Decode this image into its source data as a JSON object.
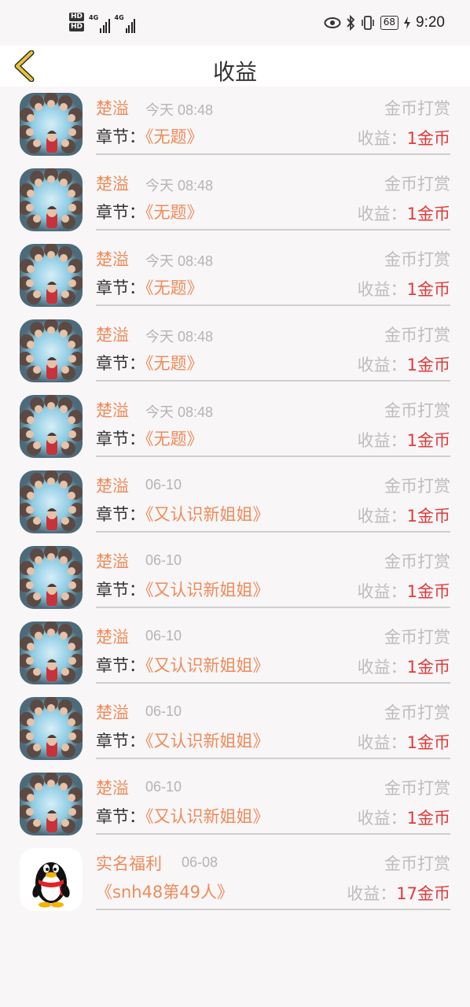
{
  "status_bar": {
    "hd1": "HD",
    "hd2": "HD",
    "net1": "4G",
    "net2": "4G",
    "battery": "68",
    "time": "9:20"
  },
  "header": {
    "title": "收益"
  },
  "colors": {
    "accent_orange": "#ed8b5a",
    "earn_red": "#e03a3a",
    "muted_gray": "#bdbdbd",
    "back_icon_yellow": "#e7c23a"
  },
  "items": [
    {
      "name": "楚溢",
      "time": "今天 08:48",
      "type": "金币打赏",
      "chapter_label": "章节：",
      "chapter_title": "《无题》",
      "earn_label": "收益：",
      "earn_value": "1金币",
      "avatar": "group-photo"
    },
    {
      "name": "楚溢",
      "time": "今天 08:48",
      "type": "金币打赏",
      "chapter_label": "章节：",
      "chapter_title": "《无题》",
      "earn_label": "收益：",
      "earn_value": "1金币",
      "avatar": "group-photo"
    },
    {
      "name": "楚溢",
      "time": "今天 08:48",
      "type": "金币打赏",
      "chapter_label": "章节：",
      "chapter_title": "《无题》",
      "earn_label": "收益：",
      "earn_value": "1金币",
      "avatar": "group-photo"
    },
    {
      "name": "楚溢",
      "time": "今天 08:48",
      "type": "金币打赏",
      "chapter_label": "章节：",
      "chapter_title": "《无题》",
      "earn_label": "收益：",
      "earn_value": "1金币",
      "avatar": "group-photo"
    },
    {
      "name": "楚溢",
      "time": "今天 08:48",
      "type": "金币打赏",
      "chapter_label": "章节：",
      "chapter_title": "《无题》",
      "earn_label": "收益：",
      "earn_value": "1金币",
      "avatar": "group-photo"
    },
    {
      "name": "楚溢",
      "time": "06-10",
      "type": "金币打赏",
      "chapter_label": "章节：",
      "chapter_title": "《又认识新姐姐》",
      "earn_label": "收益：",
      "earn_value": "1金币",
      "avatar": "group-photo"
    },
    {
      "name": "楚溢",
      "time": "06-10",
      "type": "金币打赏",
      "chapter_label": "章节：",
      "chapter_title": "《又认识新姐姐》",
      "earn_label": "收益：",
      "earn_value": "1金币",
      "avatar": "group-photo"
    },
    {
      "name": "楚溢",
      "time": "06-10",
      "type": "金币打赏",
      "chapter_label": "章节：",
      "chapter_title": "《又认识新姐姐》",
      "earn_label": "收益：",
      "earn_value": "1金币",
      "avatar": "group-photo"
    },
    {
      "name": "楚溢",
      "time": "06-10",
      "type": "金币打赏",
      "chapter_label": "章节：",
      "chapter_title": "《又认识新姐姐》",
      "earn_label": "收益：",
      "earn_value": "1金币",
      "avatar": "group-photo"
    },
    {
      "name": "楚溢",
      "time": "06-10",
      "type": "金币打赏",
      "chapter_label": "章节：",
      "chapter_title": "《又认识新姐姐》",
      "earn_label": "收益：",
      "earn_value": "1金币",
      "avatar": "group-photo"
    },
    {
      "name": "实名福利",
      "time": "06-08",
      "type": "金币打赏",
      "chapter_label": "",
      "chapter_title": "《snh48第49人》",
      "earn_label": "收益：",
      "earn_value": "17金币",
      "avatar": "qq-penguin"
    }
  ]
}
